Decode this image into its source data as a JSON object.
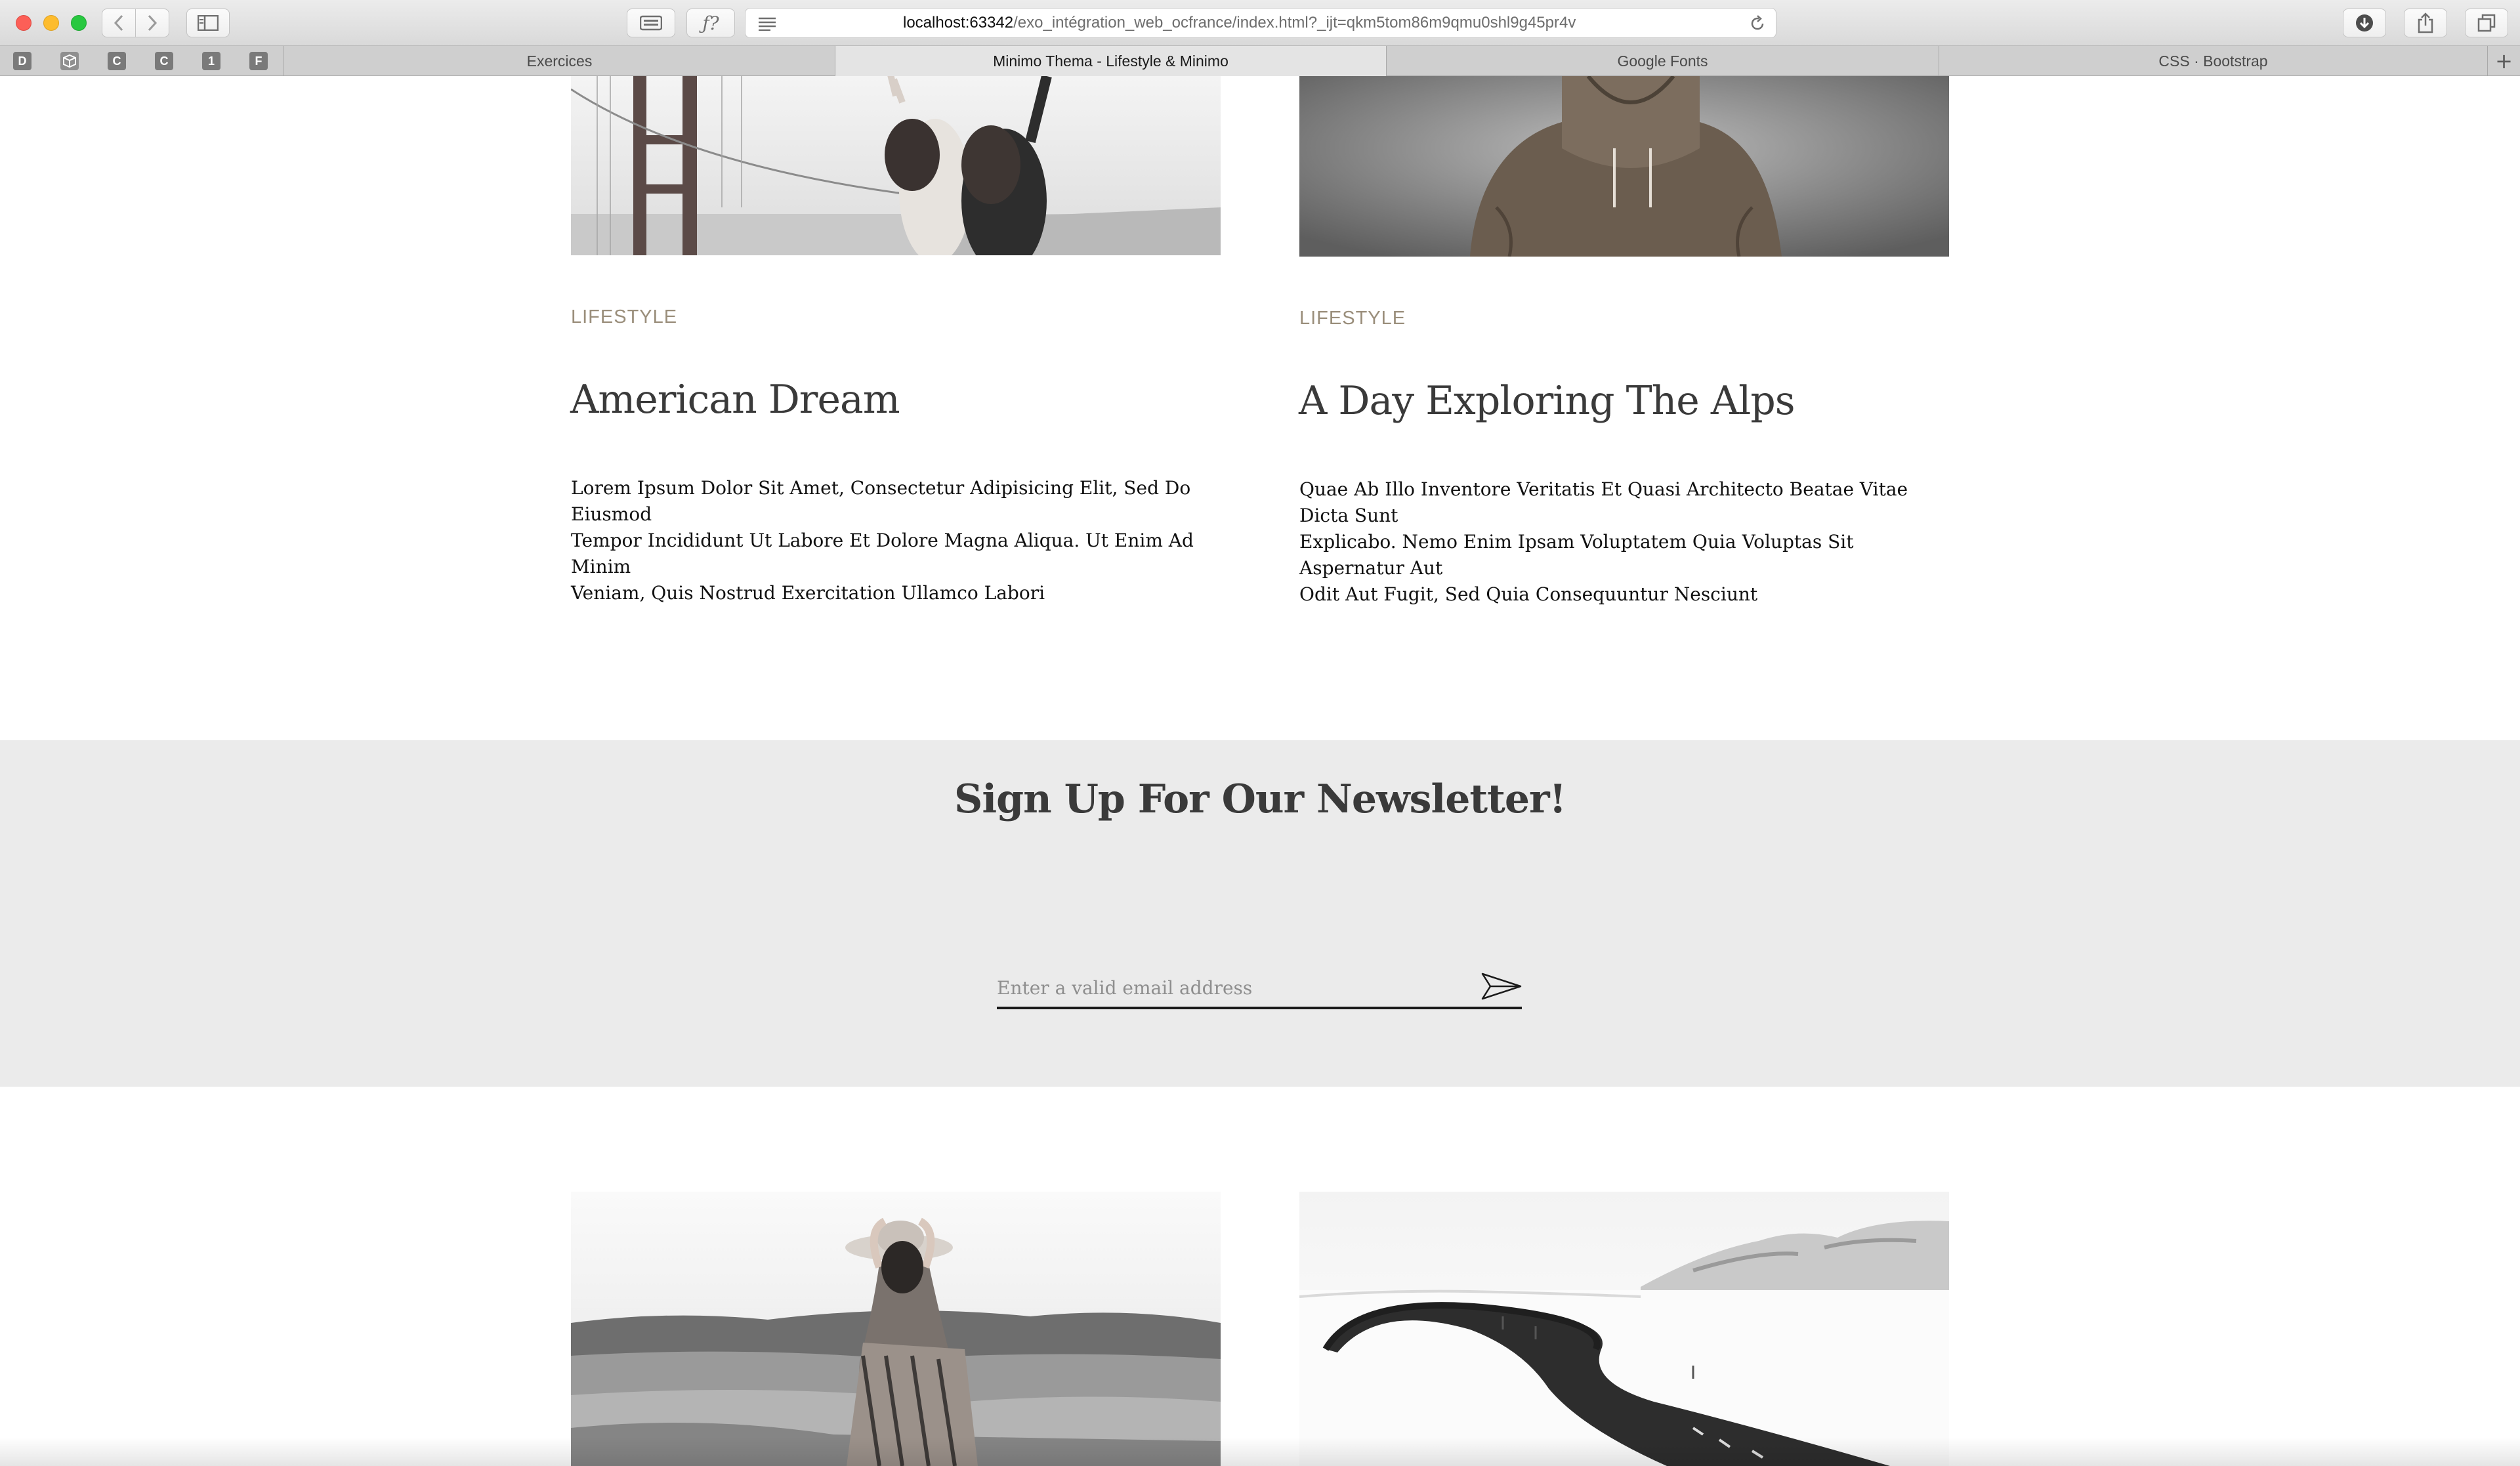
{
  "browser": {
    "url_host": "localhost:63342",
    "url_path": "/exo_intégration_web_ocfrance/index.html?_ijt=qkm5tom86m9qmu0shl9g45pr4v",
    "tabs": [
      {
        "label": "Exercices",
        "active": false
      },
      {
        "label": "Minimo Thema - Lifestyle & Minimo",
        "active": true
      },
      {
        "label": "Google Fonts",
        "active": false
      },
      {
        "label": "CSS · Bootstrap",
        "active": false
      }
    ],
    "favorites": [
      "D",
      "",
      "C",
      "C",
      "1",
      "F"
    ]
  },
  "posts_top": [
    {
      "category": "LIFESTYLE",
      "title": "American Dream",
      "lines": [
        "Lorem Ipsum Dolor Sit Amet, Consectetur Adipisicing Elit, Sed Do Eiusmod",
        "Tempor Incididunt Ut Labore Et Dolore Magna Aliqua. Ut Enim Ad Minim",
        "Veniam, Quis Nostrud Exercitation Ullamco Labori"
      ]
    },
    {
      "category": "LIFESTYLE",
      "title": "A Day Exploring The Alps",
      "lines": [
        "Quae Ab Illo Inventore Veritatis Et Quasi Architecto Beatae Vitae Dicta Sunt",
        "Explicabo. Nemo Enim Ipsam Voluptatem Quia Voluptas Sit Aspernatur Aut",
        "Odit Aut Fugit, Sed Quia Consequuntur Nesciunt"
      ]
    }
  ],
  "newsletter": {
    "title": "Sign Up For Our Newsletter!",
    "placeholder": "Enter a valid email address",
    "send_icon": "paper-plane-icon"
  },
  "icons": {
    "back": "chevron-left-icon",
    "forward": "chevron-right-icon",
    "sidebar": "sidebar-icon",
    "reload": "reload-icon",
    "download": "download-icon",
    "share": "share-icon",
    "tabs": "tabs-overview-icon"
  }
}
